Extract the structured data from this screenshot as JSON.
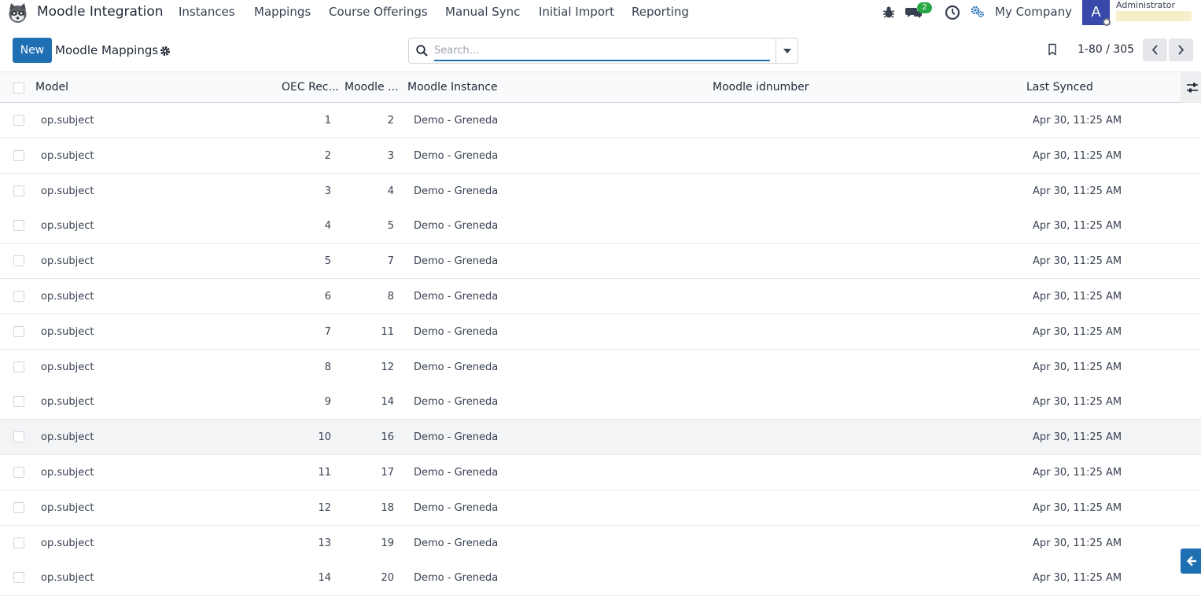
{
  "navbar": {
    "app_title": "Moodle Integration",
    "menu": [
      {
        "label": "Instances"
      },
      {
        "label": "Mappings"
      },
      {
        "label": "Course Offerings"
      },
      {
        "label": "Manual Sync"
      },
      {
        "label": "Initial Import"
      },
      {
        "label": "Reporting"
      }
    ],
    "messages_count": "2",
    "company": "My Company",
    "avatar_letter": "A",
    "user_name": "Administrator"
  },
  "control": {
    "new_label": "New",
    "breadcrumb": "Moodle Mappings",
    "search_placeholder": "Search...",
    "pager": "1-80 / 305"
  },
  "table": {
    "headers": {
      "model": "Model",
      "oec_record": "OEC Rec...",
      "moodle_id": "Moodle ...",
      "instance": "Moodle Instance",
      "idnumber": "Moodle idnumber",
      "last_synced": "Last Synced"
    },
    "rows": [
      {
        "model": "op.subject",
        "oec": "1",
        "moodle": "2",
        "instance": "Demo - Greneda",
        "idnumber": "",
        "synced": "Apr 30, 11:25 AM"
      },
      {
        "model": "op.subject",
        "oec": "2",
        "moodle": "3",
        "instance": "Demo - Greneda",
        "idnumber": "",
        "synced": "Apr 30, 11:25 AM"
      },
      {
        "model": "op.subject",
        "oec": "3",
        "moodle": "4",
        "instance": "Demo - Greneda",
        "idnumber": "",
        "synced": "Apr 30, 11:25 AM"
      },
      {
        "model": "op.subject",
        "oec": "4",
        "moodle": "5",
        "instance": "Demo - Greneda",
        "idnumber": "",
        "synced": "Apr 30, 11:25 AM"
      },
      {
        "model": "op.subject",
        "oec": "5",
        "moodle": "7",
        "instance": "Demo - Greneda",
        "idnumber": "",
        "synced": "Apr 30, 11:25 AM"
      },
      {
        "model": "op.subject",
        "oec": "6",
        "moodle": "8",
        "instance": "Demo - Greneda",
        "idnumber": "",
        "synced": "Apr 30, 11:25 AM"
      },
      {
        "model": "op.subject",
        "oec": "7",
        "moodle": "11",
        "instance": "Demo - Greneda",
        "idnumber": "",
        "synced": "Apr 30, 11:25 AM"
      },
      {
        "model": "op.subject",
        "oec": "8",
        "moodle": "12",
        "instance": "Demo - Greneda",
        "idnumber": "",
        "synced": "Apr 30, 11:25 AM"
      },
      {
        "model": "op.subject",
        "oec": "9",
        "moodle": "14",
        "instance": "Demo - Greneda",
        "idnumber": "",
        "synced": "Apr 30, 11:25 AM"
      },
      {
        "model": "op.subject",
        "oec": "10",
        "moodle": "16",
        "instance": "Demo - Greneda",
        "idnumber": "",
        "synced": "Apr 30, 11:25 AM"
      },
      {
        "model": "op.subject",
        "oec": "11",
        "moodle": "17",
        "instance": "Demo - Greneda",
        "idnumber": "",
        "synced": "Apr 30, 11:25 AM"
      },
      {
        "model": "op.subject",
        "oec": "12",
        "moodle": "18",
        "instance": "Demo - Greneda",
        "idnumber": "",
        "synced": "Apr 30, 11:25 AM"
      },
      {
        "model": "op.subject",
        "oec": "13",
        "moodle": "19",
        "instance": "Demo - Greneda",
        "idnumber": "",
        "synced": "Apr 30, 11:25 AM"
      },
      {
        "model": "op.subject",
        "oec": "14",
        "moodle": "20",
        "instance": "Demo - Greneda",
        "idnumber": "",
        "synced": "Apr 30, 11:25 AM"
      }
    ]
  },
  "colors": {
    "primary": "#1f6fb3",
    "badge": "#28a745",
    "avatar": "#3949ab"
  }
}
